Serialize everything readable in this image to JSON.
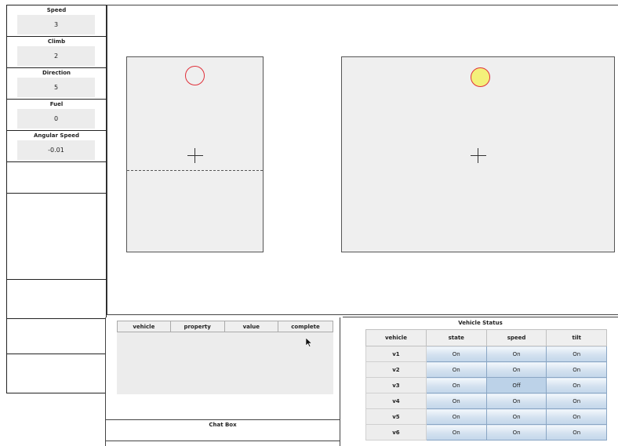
{
  "gauges": [
    {
      "label": "Speed",
      "value": "3"
    },
    {
      "label": "Climb",
      "value": "2"
    },
    {
      "label": "Direction",
      "value": "5"
    },
    {
      "label": "Fuel",
      "value": "0"
    },
    {
      "label": "Angular Speed",
      "value": "-0.01"
    }
  ],
  "task_table": {
    "headers": [
      "vehicle",
      "property",
      "value",
      "complete"
    ]
  },
  "chat": {
    "title": "Chat Box"
  },
  "vehicle_status": {
    "title": "Vehicle Status",
    "headers": [
      "vehicle",
      "state",
      "speed",
      "tilt"
    ],
    "rows": [
      [
        "v1",
        "On",
        "On",
        "On"
      ],
      [
        "v2",
        "On",
        "On",
        "On"
      ],
      [
        "v3",
        "On",
        "Off",
        "On"
      ],
      [
        "v4",
        "On",
        "On",
        "On"
      ],
      [
        "v5",
        "On",
        "On",
        "On"
      ],
      [
        "v6",
        "On",
        "On",
        "On"
      ]
    ]
  },
  "colors": {
    "target_ring": "#e0303a",
    "target_fill": "#f4f07a",
    "pane_bg": "#efefef"
  }
}
